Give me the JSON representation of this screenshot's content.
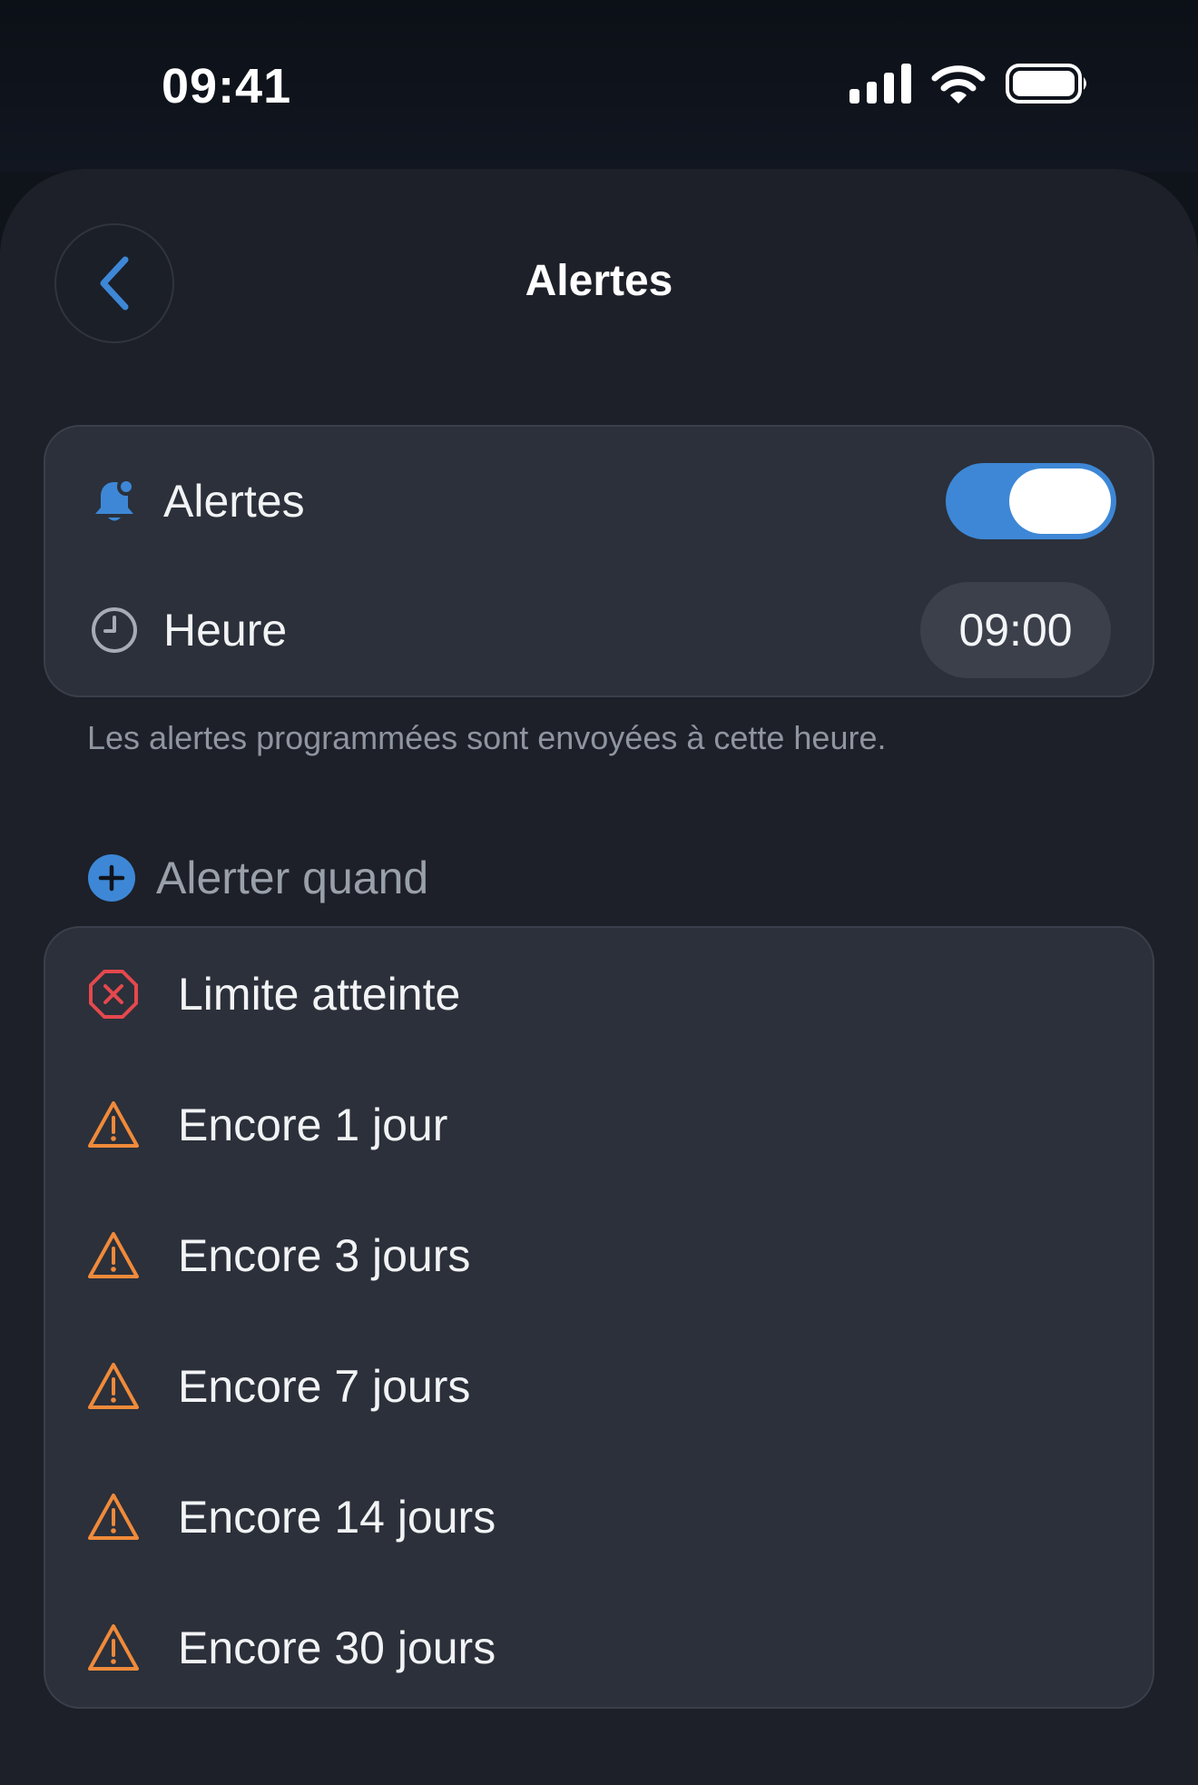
{
  "status_bar": {
    "time": "09:41"
  },
  "header": {
    "title": "Alertes",
    "back_icon": "chevron-left-icon"
  },
  "settings": {
    "alerts_label": "Alertes",
    "alerts_enabled": true,
    "time_label": "Heure",
    "time_value": "09:00",
    "caption": "Les alertes programmées sont envoyées à cette heure."
  },
  "alert_section": {
    "header": "Alerter quand",
    "items": [
      {
        "label": "Limite atteinte",
        "icon": "x-octagon-icon"
      },
      {
        "label": "Encore 1 jour",
        "icon": "warning-triangle-icon"
      },
      {
        "label": "Encore 3 jours",
        "icon": "warning-triangle-icon"
      },
      {
        "label": "Encore 7 jours",
        "icon": "warning-triangle-icon"
      },
      {
        "label": "Encore 14 jours",
        "icon": "warning-triangle-icon"
      },
      {
        "label": "Encore 30 jours",
        "icon": "warning-triangle-icon"
      }
    ]
  },
  "colors": {
    "accent_blue": "#3d87d6",
    "danger_red": "#e5484d",
    "warning_orange": "#f08a3a",
    "card": "#2b303a",
    "background": "#1d2028"
  }
}
